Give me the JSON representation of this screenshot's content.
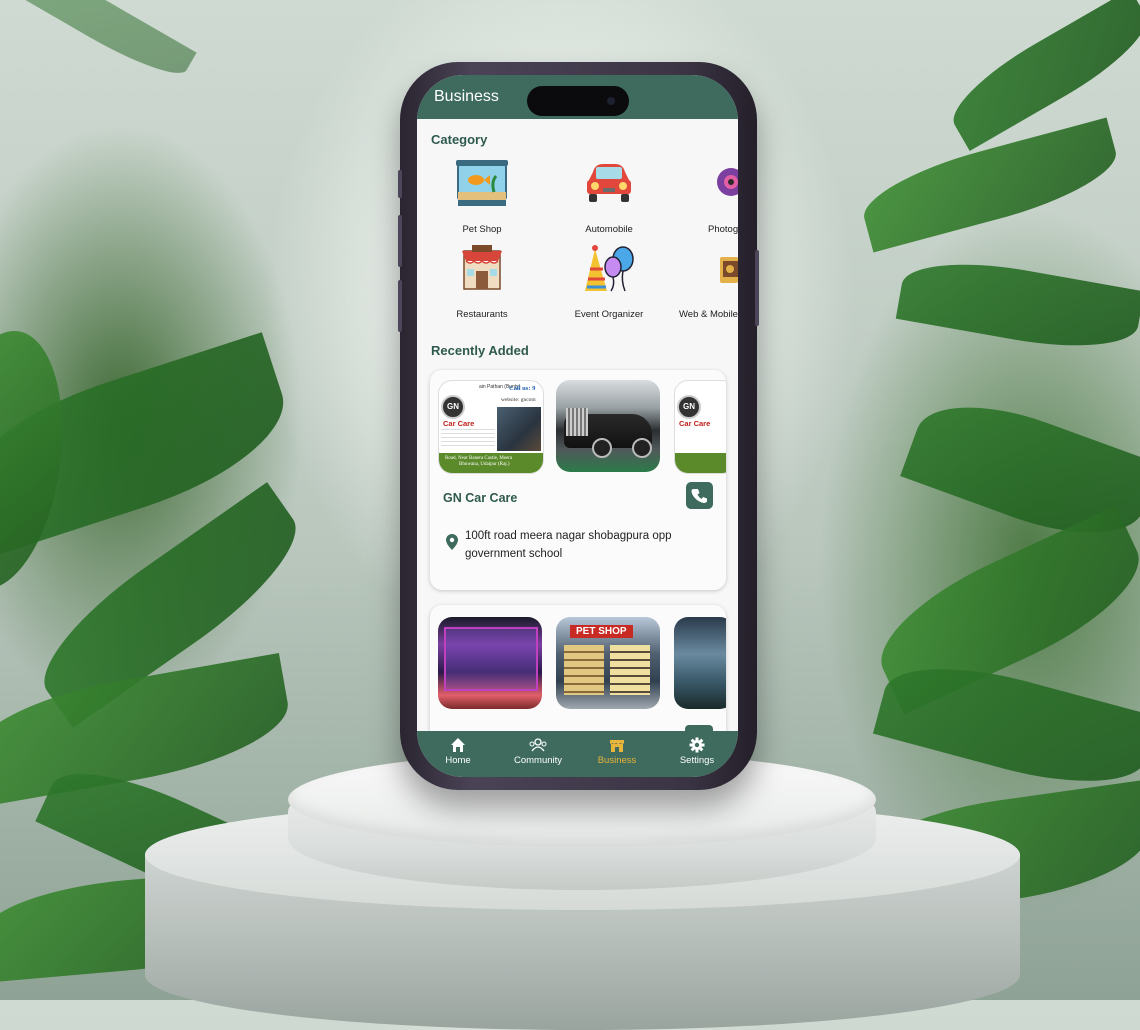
{
  "header": {
    "title": "Business"
  },
  "category": {
    "title": "Category",
    "items": [
      {
        "label": "Pet Shop",
        "icon": "aquarium-icon"
      },
      {
        "label": "Automobile",
        "icon": "car-icon"
      },
      {
        "label": "Photog",
        "icon": "camera-icon"
      },
      {
        "label": "Restaurants",
        "icon": "restaurant-icon"
      },
      {
        "label": "Event Organizer",
        "icon": "party-icon"
      },
      {
        "label": "Web & Mobile",
        "icon": "monitor-icon"
      }
    ]
  },
  "recent": {
    "title": "Recently Added",
    "cards": [
      {
        "name": "GN Car Care",
        "address": "100ft road meera nagar shobagpura opp government school",
        "thumb_texts": {
          "top": "ain Pathan (Bunty)",
          "call": "Call us: 9",
          "website": "website: gncom",
          "logo": "GN",
          "brand": "Car Care",
          "lines": "Road, Near Banera Castle, Meera",
          "lines2": "Bhuwana, Udaipur (Raj.)"
        }
      },
      {
        "name": "",
        "address": "",
        "thumb_texts": {
          "sign": "PET SHOP"
        }
      }
    ]
  },
  "nav": {
    "items": [
      {
        "label": "Home",
        "icon": "home-icon"
      },
      {
        "label": "Community",
        "icon": "community-icon"
      },
      {
        "label": "Business",
        "icon": "business-icon",
        "active": true
      },
      {
        "label": "Settings",
        "icon": "settings-icon"
      }
    ]
  },
  "colors": {
    "primary": "#3e6b5e",
    "accent": "#e8b43a",
    "background": "#f7f7f7"
  }
}
